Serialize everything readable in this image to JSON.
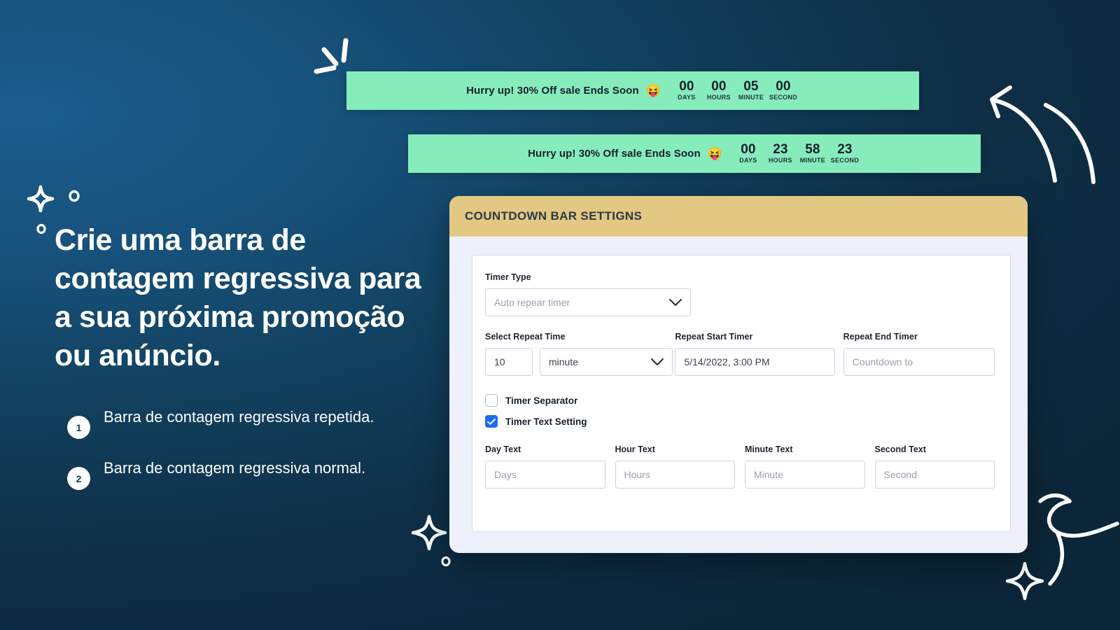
{
  "theme": {
    "bg_dark": "#0b2334",
    "bg_blue": "#1a5a86",
    "bar_green": "#86ecbb",
    "header_gold": "#e2c882",
    "panel_bg": "#eef1fb",
    "accent_checkbox": "#1f6bf0",
    "text_white": "#ffffff"
  },
  "bars": [
    {
      "message": "Hurry up! 30% Off sale Ends Soon",
      "emoji": "😝",
      "units": [
        {
          "value": "00",
          "label": "DAYS"
        },
        {
          "value": "00",
          "label": "HOURS"
        },
        {
          "value": "05",
          "label": "MINUTE"
        },
        {
          "value": "00",
          "label": "SECOND"
        }
      ]
    },
    {
      "message": "Hurry up! 30% Off sale Ends Soon",
      "emoji": "😝",
      "units": [
        {
          "value": "00",
          "label": "DAYS"
        },
        {
          "value": "23",
          "label": "HOURS"
        },
        {
          "value": "58",
          "label": "MINUTE"
        },
        {
          "value": "23",
          "label": "SECOND"
        }
      ]
    }
  ],
  "marketing": {
    "headline": "Crie uma barra de contagem regressiva para a sua próxima promoção ou anúncio.",
    "bullets": [
      {
        "number": "1",
        "text": "Barra de contagem regressiva repetida."
      },
      {
        "number": "2",
        "text": "Barra de contagem regressiva normal."
      }
    ]
  },
  "panel": {
    "title": "COUNTDOWN BAR SETTIGNS",
    "timer_type": {
      "label": "Timer Type",
      "value": "Auto repear timer"
    },
    "select_repeat_time": {
      "label": "Select Repeat Time",
      "amount_value": "10",
      "unit_value": "minute"
    },
    "repeat_start_timer": {
      "label": "Repeat Start Timer",
      "value": "5/14/2022, 3:00 PM"
    },
    "repeat_end_timer": {
      "label": "Repeat End Timer",
      "placeholder": "Countdown to"
    },
    "checkboxes": [
      {
        "label": "Timer Separator",
        "checked": false
      },
      {
        "label": "Timer Text Setting",
        "checked": true
      }
    ],
    "text_fields": [
      {
        "label": "Day Text",
        "placeholder": "Days"
      },
      {
        "label": "Hour Text",
        "placeholder": "Hours"
      },
      {
        "label": "Minute Text",
        "placeholder": "Minute"
      },
      {
        "label": "Second Text",
        "placeholder": "Second"
      }
    ]
  }
}
